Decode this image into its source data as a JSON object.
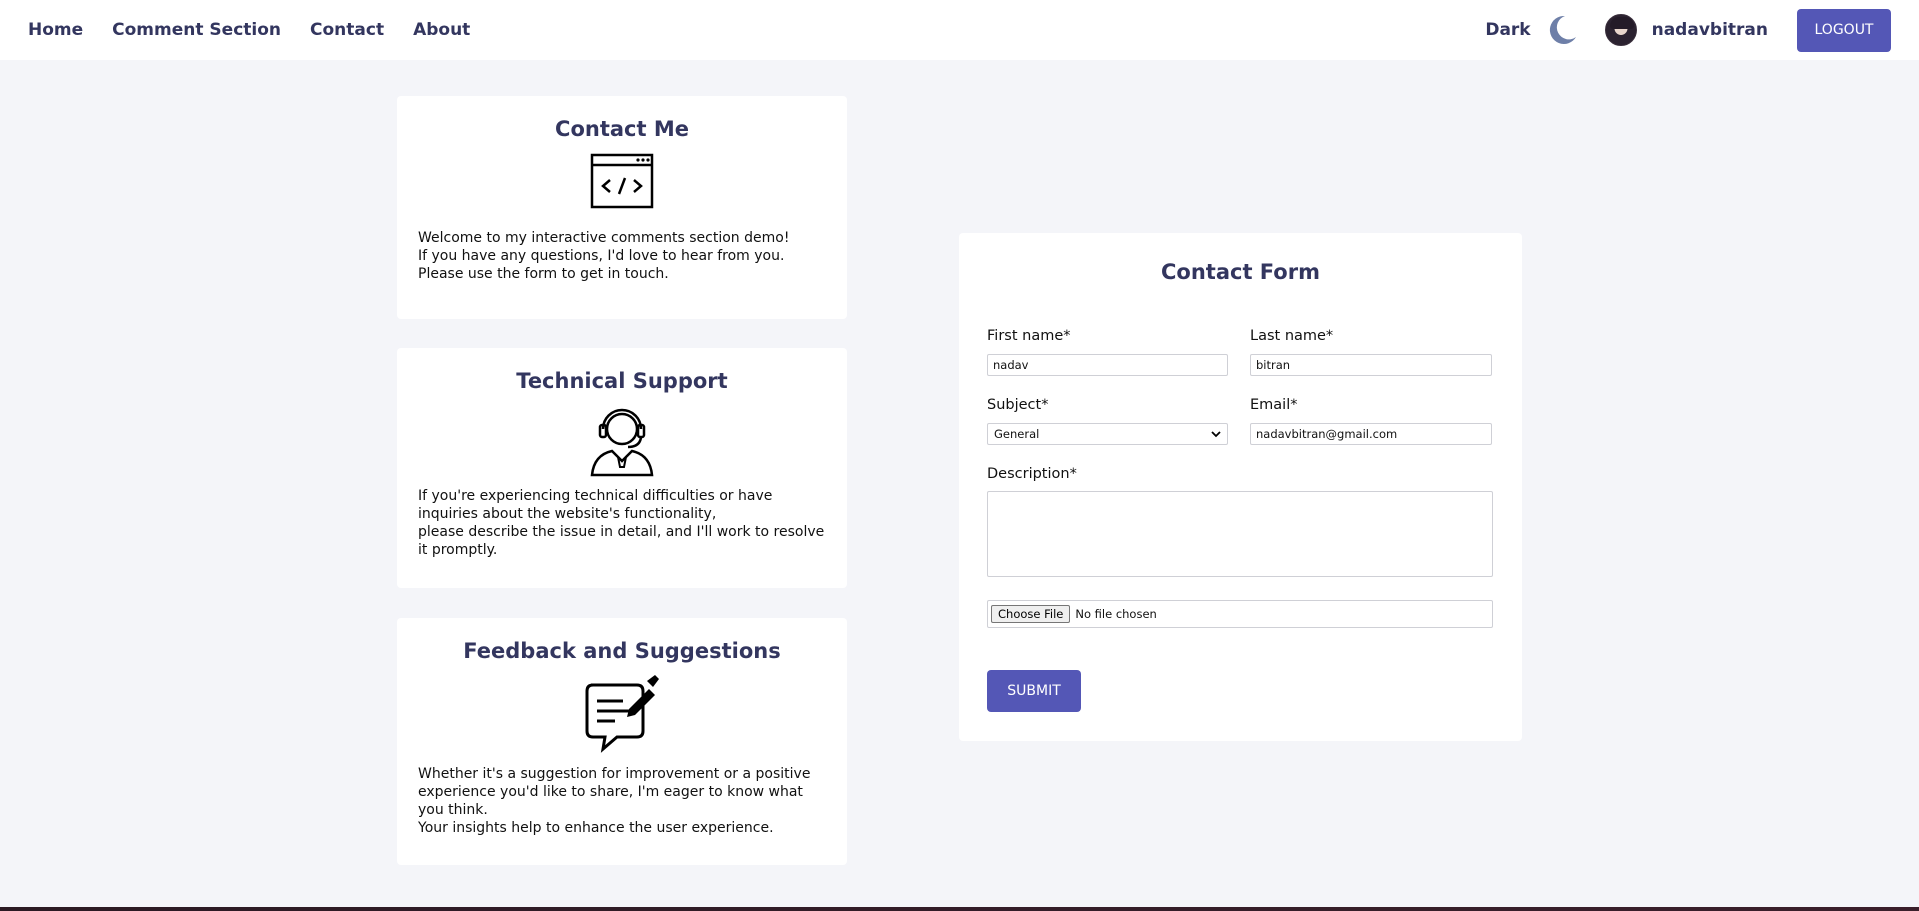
{
  "nav": {
    "links": [
      "Home",
      "Comment Section",
      "Contact",
      "About"
    ],
    "theme_label": "Dark",
    "username": "nadavbitran",
    "logout_label": "LOGOUT"
  },
  "cards": {
    "contact": {
      "title": "Contact Me",
      "lines": [
        "Welcome to my interactive comments section demo!",
        "If you have any questions, I'd love to hear from you. Please use the form to get in touch."
      ]
    },
    "support": {
      "title": "Technical Support",
      "lines": [
        "If you're experiencing technical difficulties or have inquiries about the website's functionality,",
        "please describe the issue in detail, and I'll work to resolve it promptly."
      ]
    },
    "feedback": {
      "title": "Feedback and Suggestions",
      "lines": [
        "Whether it's a suggestion for improvement or a positive experience you'd like to share, I'm eager to know what you think.",
        "Your insights help to enhance the user experience."
      ]
    }
  },
  "form": {
    "title": "Contact Form",
    "first_name_label": "First name*",
    "first_name_value": "nadav",
    "last_name_label": "Last name*",
    "last_name_value": "bitran",
    "subject_label": "Subject*",
    "subject_value": "General",
    "email_label": "Email*",
    "email_value": "nadavbitran@gmail.com",
    "description_label": "Description*",
    "file_button_label": "Choose File",
    "file_status": "No file chosen",
    "submit_label": "SUBMIT"
  },
  "colors": {
    "accent": "#5457b6",
    "heading": "#33365f",
    "background": "#f4f5f9"
  }
}
